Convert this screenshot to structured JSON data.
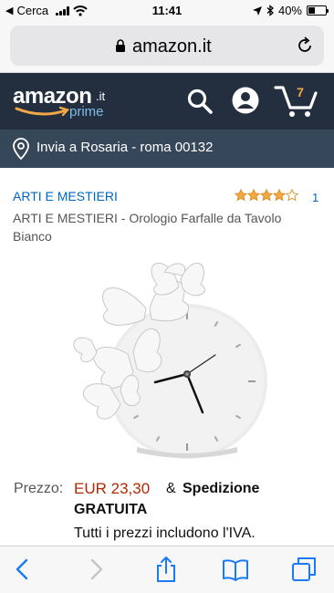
{
  "status_bar": {
    "back_label": "◀",
    "back_app": "Cerca",
    "time": "11:41",
    "battery_percent": "40%",
    "battery_level": 0.4
  },
  "address_bar": {
    "url": "amazon.it"
  },
  "header": {
    "logo_text": "amazon",
    "logo_tld": ".it",
    "logo_prime": "prime",
    "cart_count": "7",
    "colors": {
      "background": "#232f3e",
      "prime": "#7fbce6",
      "accent": "#f3a847"
    },
    "icons": [
      "search-icon",
      "account-icon",
      "cart-icon"
    ]
  },
  "location": {
    "text": "Invia a Rosaria - roma 00132",
    "icon": "location-pin-icon"
  },
  "product": {
    "brand": "ARTI E MESTIERI",
    "rating": 4,
    "rating_max": 5,
    "rating_count": "1",
    "title": "ARTI E MESTIERI - Orologio Farfalle da Tavolo Bianco"
  },
  "price": {
    "label": "Prezzo:",
    "value": "EUR 23,30",
    "shipping_amp": "&",
    "shipping_part1": "Spedizione",
    "shipping_part2": "GRATUITA",
    "vat_note": "Tutti i prezzi includono l'IVA.",
    "color": "#b12704"
  },
  "toolbar": {
    "icons": [
      "back-icon",
      "forward-icon",
      "share-icon",
      "bookmarks-icon",
      "tabs-icon"
    ],
    "accent": "#1a7cf5"
  }
}
